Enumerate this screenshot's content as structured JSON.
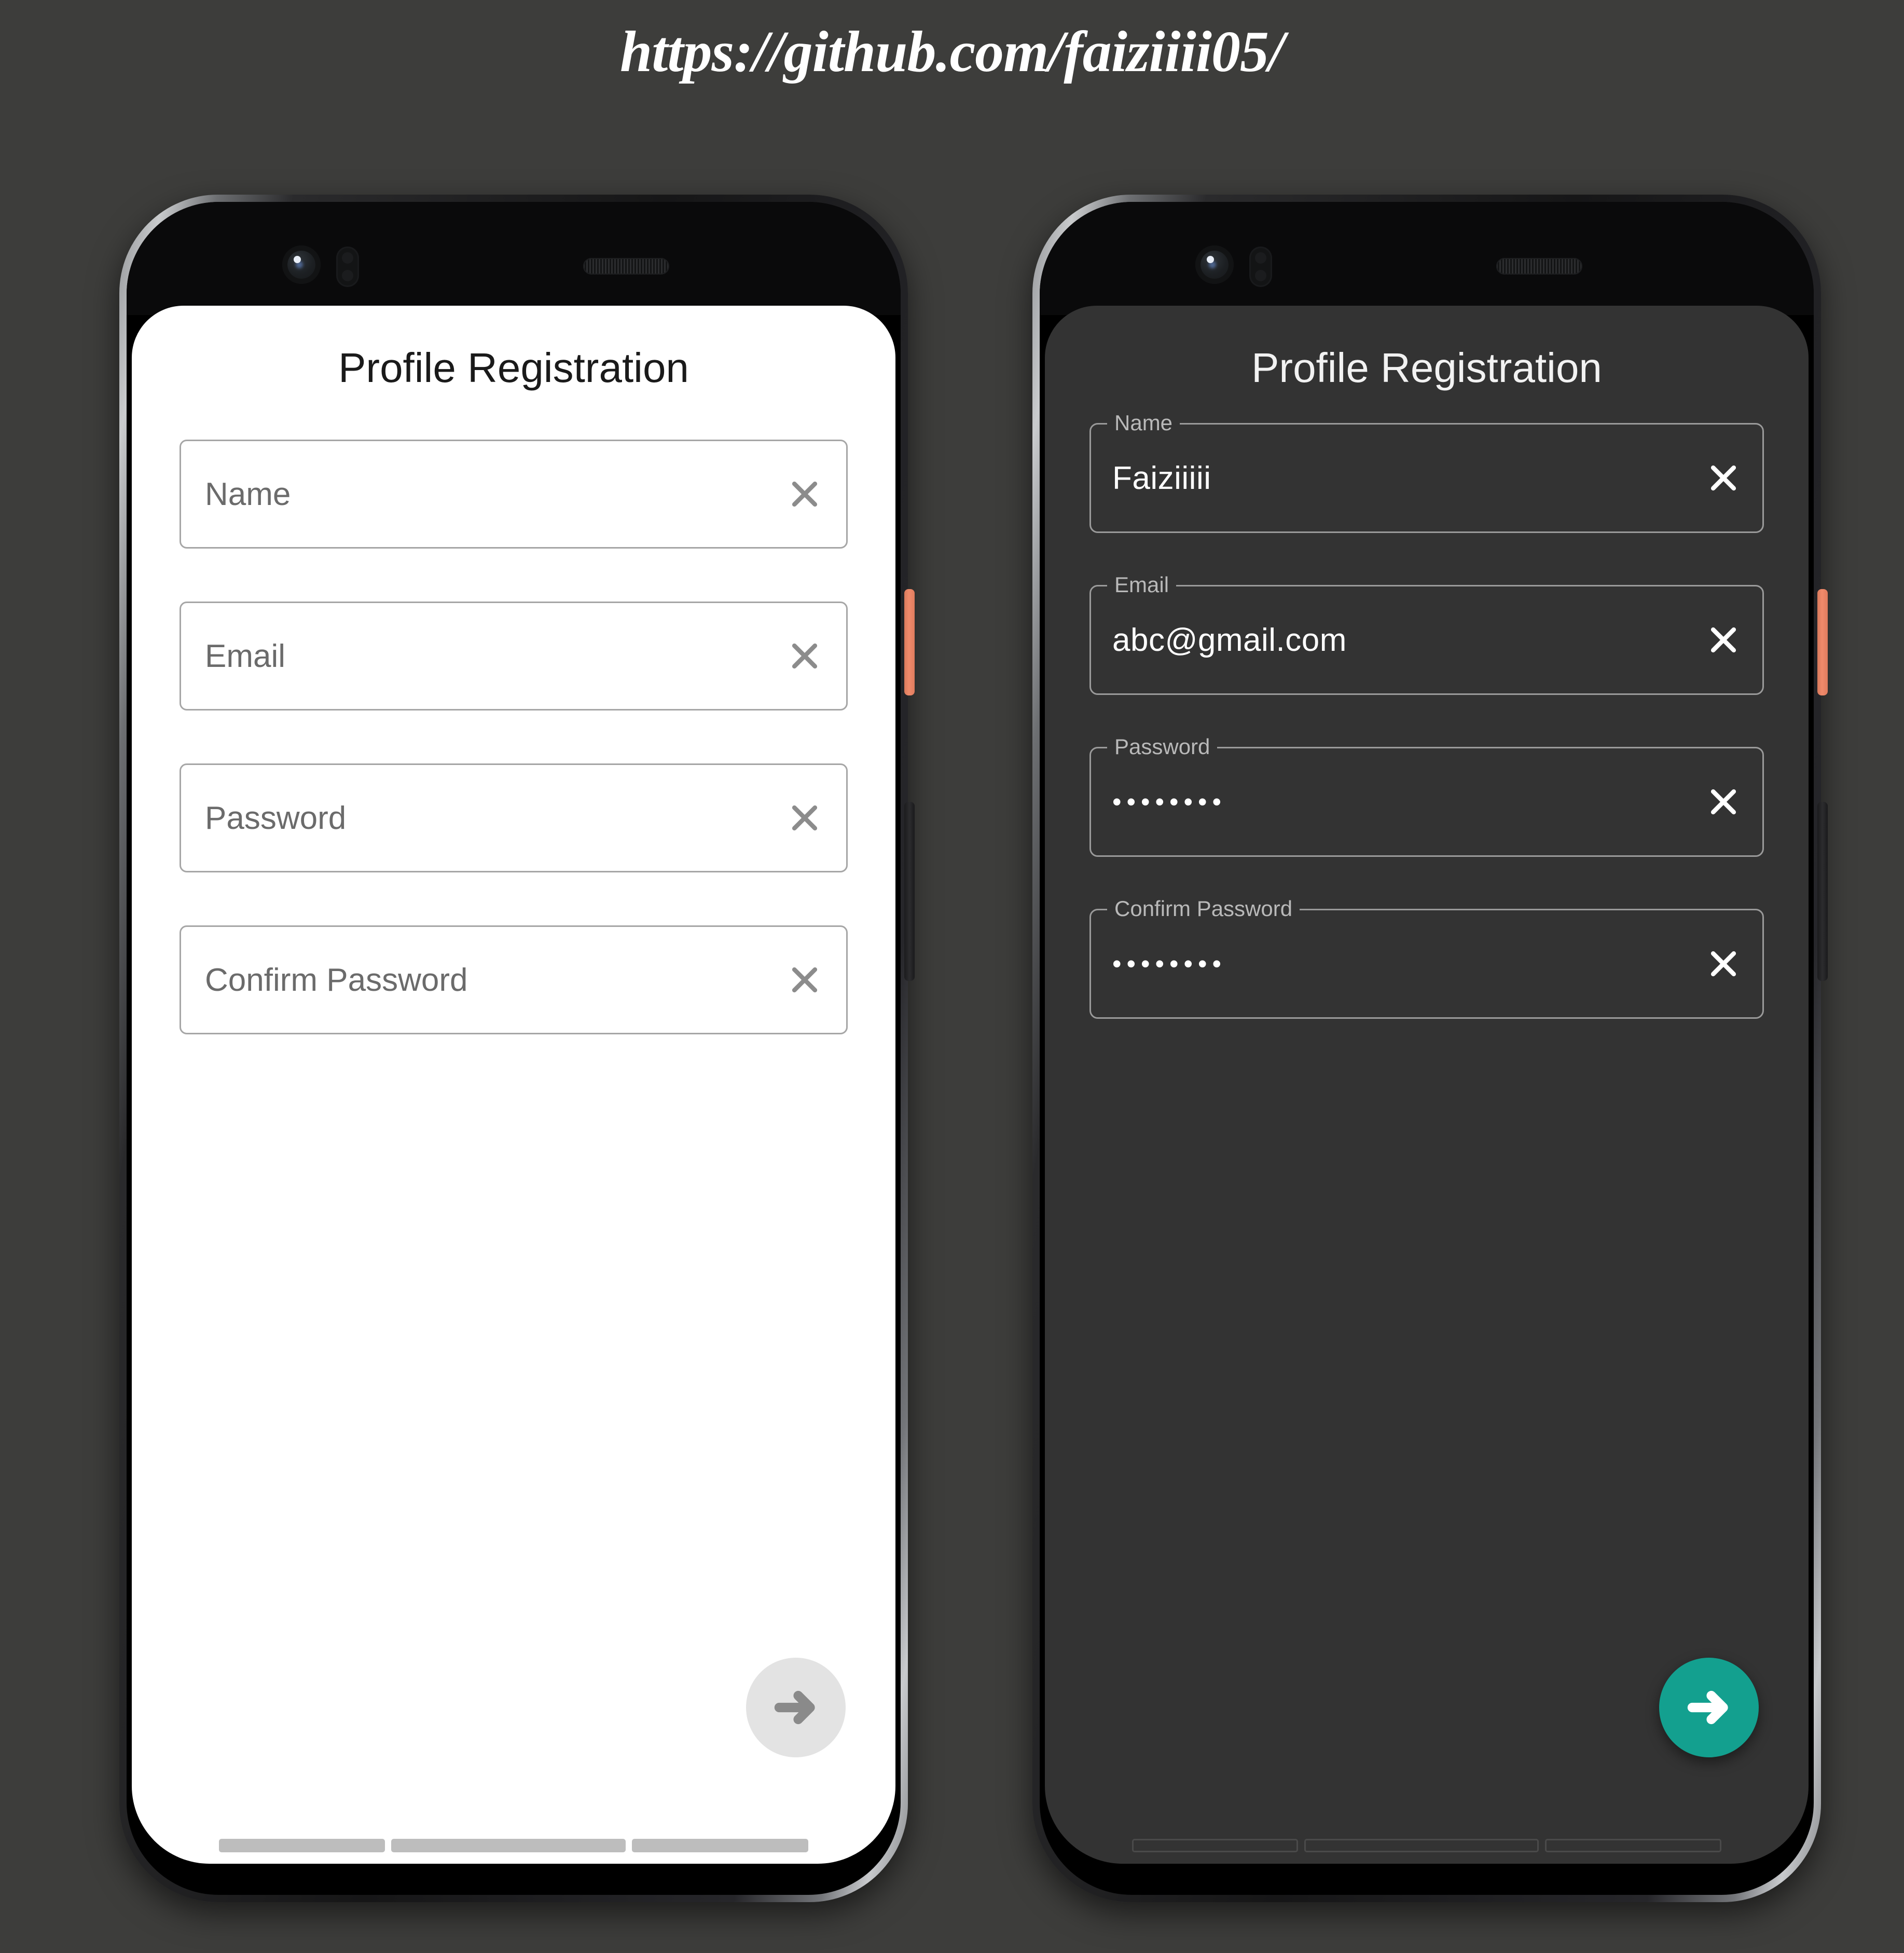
{
  "header": {
    "url": "https://github.com/faiziiii05/"
  },
  "theme_colors": {
    "page_background": "#3d3d3b",
    "light_screen_bg": "#ffffff",
    "dark_screen_bg": "#333333",
    "accent_fab_teal": "#13a08f",
    "fab_light_gray": "#e3e3e3",
    "power_button": "#f08a6b",
    "field_border_light": "#a6a6a6",
    "field_border_dark": "#9a9a9a"
  },
  "phones": [
    {
      "id": "light-theme-phone",
      "theme": "light",
      "app": {
        "title": "Profile Registration",
        "fields": [
          {
            "name": "name",
            "placeholder": "Name",
            "value": "",
            "clear_icon": "close-icon"
          },
          {
            "name": "email",
            "placeholder": "Email",
            "value": "",
            "clear_icon": "close-icon"
          },
          {
            "name": "password",
            "placeholder": "Password",
            "value": "",
            "clear_icon": "close-icon"
          },
          {
            "name": "confirm-password",
            "placeholder": "Confirm Password",
            "value": "",
            "clear_icon": "close-icon"
          }
        ],
        "fab": {
          "icon": "arrow-right-icon",
          "label": "Next"
        }
      },
      "hardware": {
        "camera": "front-camera-lens",
        "sensor": "proximity-sensor",
        "speaker": "earpiece-speaker",
        "power_button": "power-button",
        "volume_button": "volume-rocker"
      },
      "nav_bars": 3
    },
    {
      "id": "dark-theme-phone",
      "theme": "dark",
      "app": {
        "title": "Profile Registration",
        "fields": [
          {
            "name": "name",
            "label": "Name",
            "value": "Faiziiiii",
            "clear_icon": "close-icon"
          },
          {
            "name": "email",
            "label": "Email",
            "value": "abc@gmail.com",
            "clear_icon": "close-icon"
          },
          {
            "name": "password",
            "label": "Password",
            "value": "••••••••",
            "clear_icon": "close-icon"
          },
          {
            "name": "confirm-password",
            "label": "Confirm Password",
            "value": "••••••••",
            "clear_icon": "close-icon"
          }
        ],
        "fab": {
          "icon": "arrow-right-icon",
          "label": "Next"
        }
      },
      "hardware": {
        "camera": "front-camera-lens",
        "sensor": "proximity-sensor",
        "speaker": "earpiece-speaker",
        "power_button": "power-button",
        "volume_button": "volume-rocker"
      },
      "nav_bars": 3
    }
  ]
}
